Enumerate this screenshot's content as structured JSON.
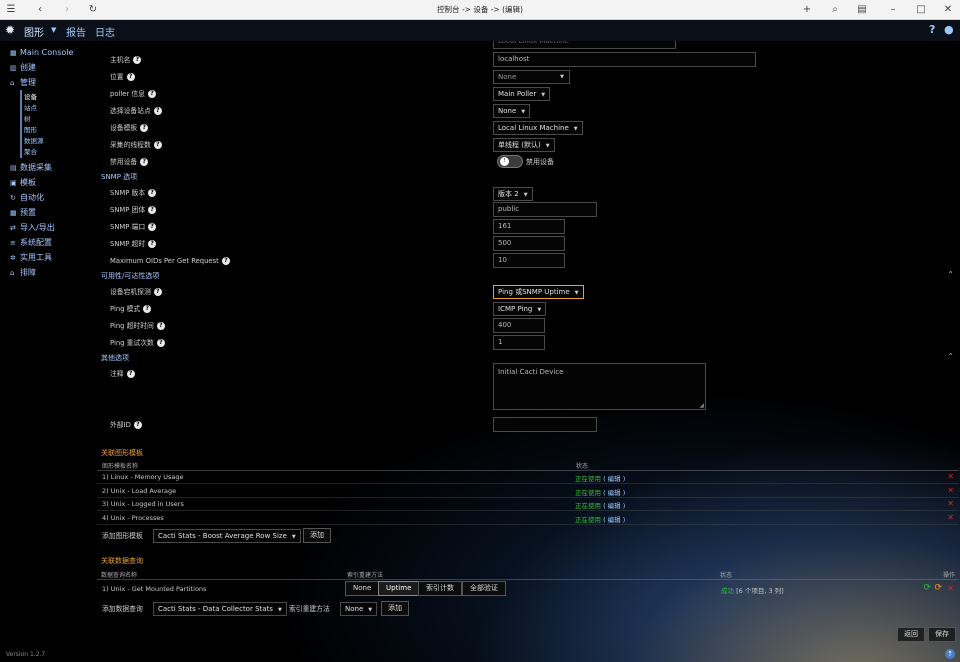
{
  "browser": {
    "title": "控制台 -> 设备 -> (编辑)"
  },
  "appbar": {
    "tabs": [
      "图形",
      "报告",
      "日志"
    ],
    "help": "?"
  },
  "sidebar": {
    "items": [
      {
        "label": "Main Console",
        "icon": "dashboard-icon"
      },
      {
        "label": "创建",
        "icon": "chart-icon"
      },
      {
        "label": "管理",
        "icon": "home-icon"
      },
      {
        "label": "数据采集",
        "icon": "db-icon"
      },
      {
        "label": "模板",
        "icon": "template-icon"
      },
      {
        "label": "自动化",
        "icon": "loop-icon"
      },
      {
        "label": "预置",
        "icon": "preset-icon"
      },
      {
        "label": "导入/导出",
        "icon": "exchange-icon"
      },
      {
        "label": "系统配置",
        "icon": "list-icon"
      },
      {
        "label": "实用工具",
        "icon": "gears-icon"
      },
      {
        "label": "排障",
        "icon": "wrench-icon"
      }
    ],
    "subitems": [
      "设备",
      "站点",
      "树",
      "图形",
      "数据源",
      "聚合"
    ]
  },
  "form": {
    "top_partial_value": "Local Linux Machine",
    "fields": {
      "hostname": {
        "label": "主机名",
        "value": "localhost"
      },
      "location": {
        "label": "位置",
        "value": "None"
      },
      "poller": {
        "label": "poller 信息",
        "value": "Main Poller"
      },
      "site": {
        "label": "选择设备站点",
        "value": "None"
      },
      "template": {
        "label": "设备模板",
        "value": "Local Linux Machine"
      },
      "threads": {
        "label": "采集的线程数",
        "value": "单线程 (默认)"
      },
      "disable": {
        "label": "禁用设备",
        "toggle_label": "禁用设备"
      }
    },
    "snmp": {
      "section": "SNMP 选项",
      "version": {
        "label": "SNMP 版本",
        "value": "版本 2"
      },
      "community": {
        "label": "SNMP 团体",
        "value": "public"
      },
      "port": {
        "label": "SNMP 端口",
        "value": "161"
      },
      "timeout": {
        "label": "SNMP 超时",
        "value": "500"
      },
      "max_oids": {
        "label": "Maximum OIDs Per Get Request",
        "value": "10"
      }
    },
    "availability": {
      "section": "可用性/可达性选项",
      "method": {
        "label": "设备宕机探测",
        "value": "Ping 或SNMP Uptime"
      },
      "ping_method": {
        "label": "Ping 模式",
        "value": "ICMP Ping"
      },
      "ping_timeout": {
        "label": "Ping 超时时间",
        "value": "400"
      },
      "ping_retries": {
        "label": "Ping 重试次数",
        "value": "1"
      }
    },
    "other": {
      "section": "其他选项",
      "notes": {
        "label": "注释",
        "value": "Initial Cacti Device"
      },
      "external_id": {
        "label": "外部ID",
        "value": ""
      }
    }
  },
  "graph_templates": {
    "section": "关联图形模板",
    "col_name": "图形模板名称",
    "col_status": "状态",
    "rows": [
      {
        "name": "1) Linux - Memory Usage",
        "status": "正在使用",
        "edit": "( 编辑 )"
      },
      {
        "name": "2) Unix - Load Average",
        "status": "正在使用",
        "edit": "( 编辑 )"
      },
      {
        "name": "3) Unix - Logged in Users",
        "status": "正在使用",
        "edit": "( 编辑 )"
      },
      {
        "name": "4) Unix - Processes",
        "status": "正在使用",
        "edit": "( 编辑 )"
      }
    ],
    "add_label": "添加图形模板",
    "add_select": "Cacti Stats - Boost Average Row Size",
    "add_button": "添加"
  },
  "data_queries": {
    "section": "关联数据查询",
    "col_name": "数据查询名称",
    "col_reindex": "索引重建方法",
    "col_status": "状态",
    "col_actions": "操作",
    "rows": [
      {
        "name": "1) Unix - Get Mounted Partitions",
        "status_ok": "成功",
        "status_text": "[6 个项目, 3 列]"
      }
    ],
    "reindex_options": [
      "None",
      "Uptime",
      "索引计数",
      "全部验证"
    ],
    "reindex_selected": "Uptime",
    "add_label": "添加数据查询",
    "add_select": "Cacti Stats - Data Collector Stats",
    "reindex_label": "索引重建方法",
    "reindex_value": "None",
    "add_button": "添加"
  },
  "actions": {
    "back": "返回",
    "save": "保存"
  },
  "footer": {
    "version": "Version 1.2.7"
  }
}
